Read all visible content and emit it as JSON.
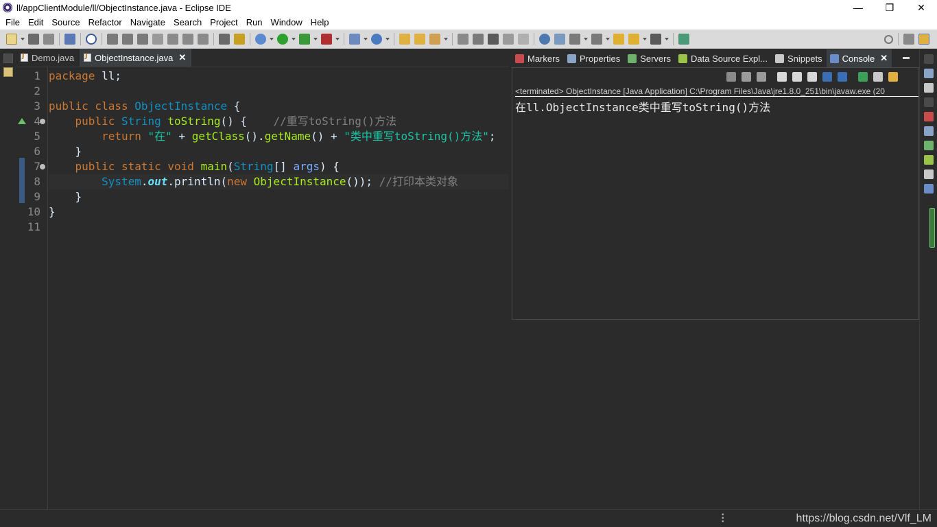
{
  "window": {
    "title": "ll/appClientModule/ll/ObjectInstance.java - Eclipse IDE",
    "controls": {
      "minimize": "—",
      "maximize": "❐",
      "close": "✕"
    }
  },
  "menu": [
    "File",
    "Edit",
    "Source",
    "Refactor",
    "Navigate",
    "Search",
    "Project",
    "Run",
    "Window",
    "Help"
  ],
  "editor": {
    "tabs": [
      {
        "label": "Demo.java",
        "active": false
      },
      {
        "label": "ObjectInstance.java",
        "active": true,
        "close": "✕"
      }
    ],
    "line_numbers": [
      "1",
      "2",
      "3",
      "4",
      "5",
      "6",
      "7",
      "8",
      "9",
      "10",
      "11"
    ],
    "code": {
      "l1_kw": "package",
      "l1_rest": " ll;",
      "l3_kw": "public class",
      "l3_cls": "ObjectInstance",
      "l3_rest": " {",
      "l4_kw": "public",
      "l4_ty": "String",
      "l4_fn": "toString",
      "l4_rest": "() {",
      "l4_cm": "//重写toString()方法",
      "l5_kw": "return",
      "l5_st1": "\"在\"",
      "l5_op1": " + ",
      "l5_fn1": "getClass",
      "l5_mid": "().",
      "l5_fn2": "getName",
      "l5_op2": "() + ",
      "l5_st2": "\"类中重写toString()方法\"",
      "l5_end": ";",
      "l6": "}",
      "l7_kw": "public static void",
      "l7_fn": "main",
      "l7_p1": "(",
      "l7_ty": "String",
      "l7_p2": "[] ",
      "l7_arg": "args",
      "l7_rest": ") {",
      "l8_cls": "System",
      "l8_dot": ".",
      "l8_fld": "out",
      "l8_call": ".println(",
      "l8_new": "new",
      "l8_cls2": "ObjectInstance",
      "l8_end": "());",
      "l8_cm": "//打印本类对象",
      "l9": "}",
      "l10": "}"
    }
  },
  "views": {
    "tabs": [
      {
        "label": "Markers",
        "icon": "markers-icon",
        "color": "#c94c4c"
      },
      {
        "label": "Properties",
        "icon": "properties-icon",
        "color": "#8aa4c8"
      },
      {
        "label": "Servers",
        "icon": "servers-icon",
        "color": "#6db36d"
      },
      {
        "label": "Data Source Expl...",
        "icon": "data-source-icon",
        "color": "#9ac34a"
      },
      {
        "label": "Snippets",
        "icon": "snippets-icon",
        "color": "#c8c8c8"
      },
      {
        "label": "Console",
        "icon": "console-icon",
        "color": "#6a8cc8",
        "active": true,
        "close": "✕"
      }
    ],
    "console": {
      "status": "<terminated> ObjectInstance [Java Application] C:\\Program Files\\Java\\jre1.8.0_251\\bin\\javaw.exe  (20",
      "output": "在ll.ObjectInstance类中重写toString()方法"
    }
  },
  "statusbar": {
    "watermark": "https://blog.csdn.net/Vlf_LM"
  }
}
